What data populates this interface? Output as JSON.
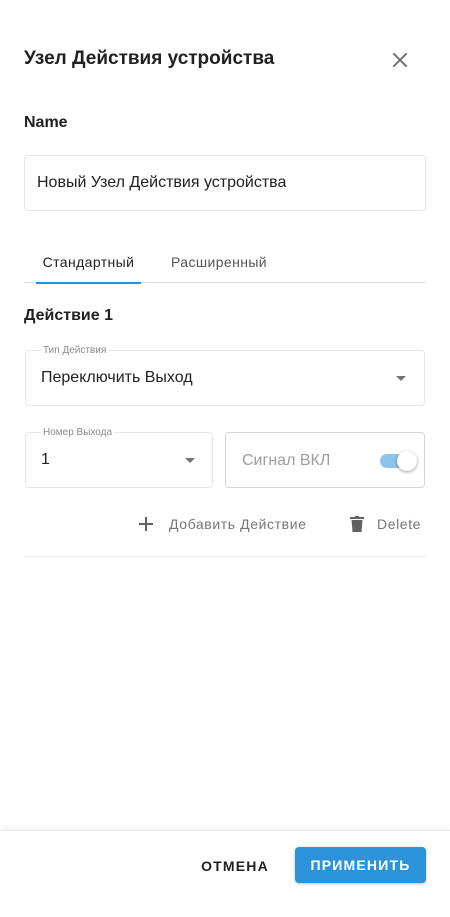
{
  "dialog": {
    "title": "Узел Действия устройства"
  },
  "name_field": {
    "label": "Name",
    "value": "Новый Узел Действия устройства"
  },
  "tabs": [
    {
      "label": "Стандартный",
      "active": true
    },
    {
      "label": "Расширенный",
      "active": false
    }
  ],
  "action": {
    "title": "Действие 1",
    "type_select": {
      "label": "Тип Действия",
      "value": "Переключить Выход"
    },
    "output_select": {
      "label": "Номер Выхода",
      "value": "1"
    },
    "signal": {
      "label": "Сигнал ВКЛ",
      "on": true
    },
    "add_label": "Добавить Действие",
    "delete_label": "Delete"
  },
  "footer": {
    "cancel_label": "ОТМЕНА",
    "apply_label": "ПРИМЕНИТЬ"
  },
  "colors": {
    "accent": "#2b93d9",
    "toggle_track": "#8cc4ee"
  },
  "icons": {
    "close": "close-icon",
    "dropdown": "chevron-down-icon",
    "add": "plus-icon",
    "delete": "trash-icon"
  }
}
